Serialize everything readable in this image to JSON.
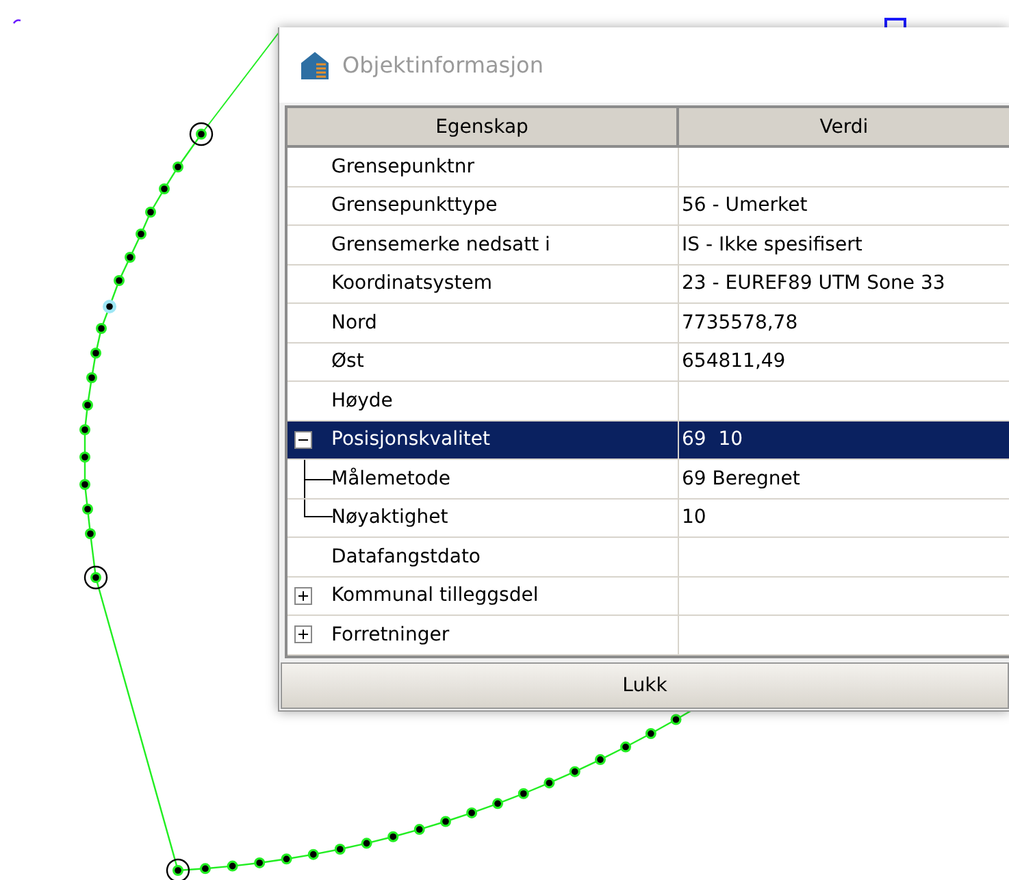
{
  "dialog": {
    "title": "Objektinformasjon",
    "columns": [
      "Egenskap",
      "Verdi"
    ],
    "rows": [
      {
        "property": "Grensepunktnr",
        "value": "",
        "selected": false
      },
      {
        "property": "Grensepunkttype",
        "value": "56 - Umerket",
        "selected": false
      },
      {
        "property": "Grensemerke nedsatt i",
        "value": "IS - Ikke spesifisert",
        "selected": false
      },
      {
        "property": "Koordinatsystem",
        "value": "23 - EUREF89 UTM Sone 33",
        "selected": false
      },
      {
        "property": "Nord",
        "value": "7735578,78",
        "selected": false
      },
      {
        "property": "Øst",
        "value": "654811,49",
        "selected": false
      },
      {
        "property": "Høyde",
        "value": "",
        "selected": false
      },
      {
        "property": "Posisjonskvalitet",
        "value": "69  10",
        "selected": true,
        "expanded": true,
        "children": [
          {
            "property": "Målemetode",
            "value": "69 Beregnet",
            "selected": false
          },
          {
            "property": "Nøyaktighet",
            "value": "10",
            "selected": false
          }
        ]
      },
      {
        "property": "Datafangstdato",
        "value": "",
        "selected": false
      },
      {
        "property": "Kommunal tilleggsdel",
        "value": "",
        "selected": false,
        "expanded": false
      },
      {
        "property": "Forretninger",
        "value": "",
        "selected": false,
        "expanded": false
      }
    ],
    "button": "Lukk"
  }
}
